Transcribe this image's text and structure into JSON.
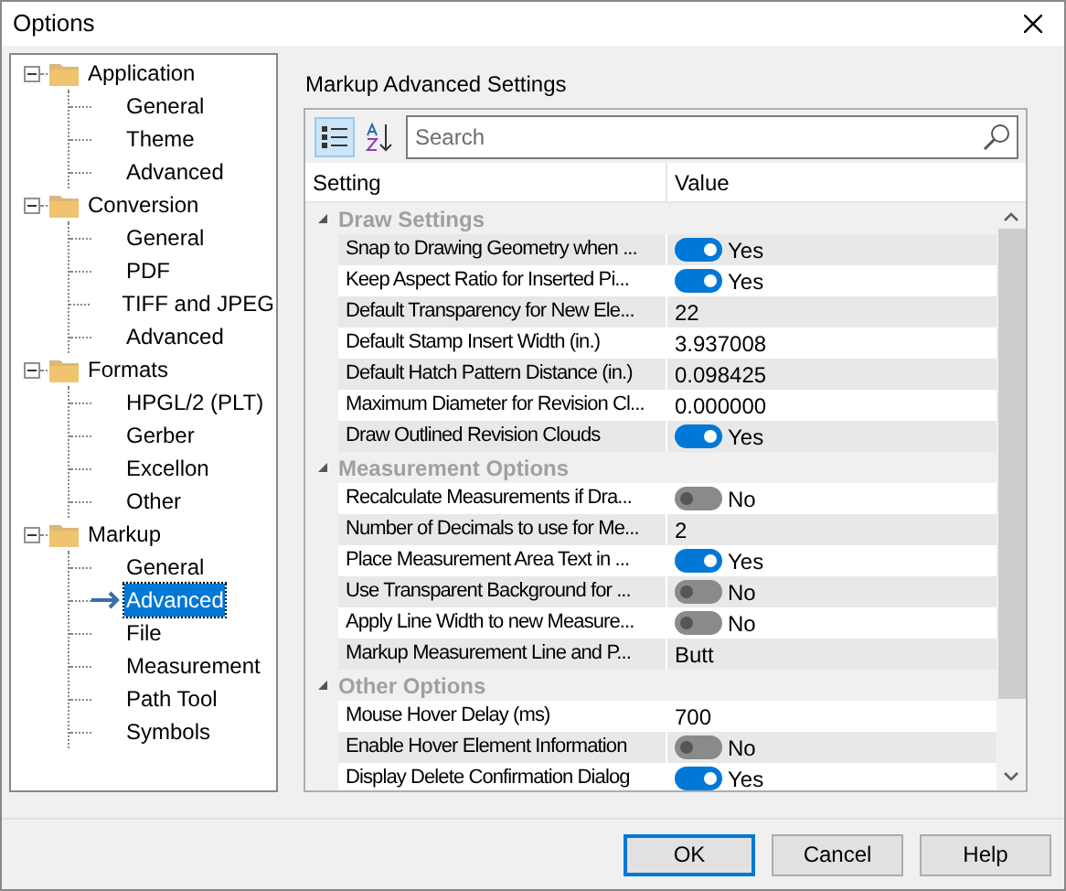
{
  "window": {
    "title": "Options"
  },
  "tree": [
    {
      "label": "Application",
      "expanded": true,
      "children": [
        {
          "label": "General",
          "selected": false
        },
        {
          "label": "Theme",
          "selected": false
        },
        {
          "label": "Advanced",
          "selected": false
        }
      ]
    },
    {
      "label": "Conversion",
      "expanded": true,
      "children": [
        {
          "label": "General",
          "selected": false
        },
        {
          "label": "PDF",
          "selected": false
        },
        {
          "label": "TIFF and JPEG",
          "selected": false
        },
        {
          "label": "Advanced",
          "selected": false
        }
      ]
    },
    {
      "label": "Formats",
      "expanded": true,
      "children": [
        {
          "label": "HPGL/2 (PLT)",
          "selected": false
        },
        {
          "label": "Gerber",
          "selected": false
        },
        {
          "label": "Excellon",
          "selected": false
        },
        {
          "label": "Other",
          "selected": false
        }
      ]
    },
    {
      "label": "Markup",
      "expanded": true,
      "children": [
        {
          "label": "General",
          "selected": false
        },
        {
          "label": "Advanced",
          "selected": true
        },
        {
          "label": "File",
          "selected": false
        },
        {
          "label": "Measurement",
          "selected": false
        },
        {
          "label": "Path Tool",
          "selected": false
        },
        {
          "label": "Symbols",
          "selected": false
        }
      ]
    }
  ],
  "panel_title": "Markup Advanced Settings",
  "search": {
    "placeholder": "Search"
  },
  "grid": {
    "columns": [
      "Setting",
      "Value"
    ],
    "groups": [
      {
        "label": "Draw Settings",
        "expanded": true,
        "rows": [
          {
            "setting": "Snap to Drawing Geometry when ...",
            "kind": "toggle",
            "on": true,
            "value": "Yes"
          },
          {
            "setting": "Keep Aspect Ratio for Inserted Pi...",
            "kind": "toggle",
            "on": true,
            "value": "Yes"
          },
          {
            "setting": "Default Transparency for New Ele...",
            "kind": "text",
            "value": "22"
          },
          {
            "setting": "Default Stamp Insert Width (in.)",
            "kind": "text",
            "value": "3.937008"
          },
          {
            "setting": "Default Hatch Pattern Distance (in.)",
            "kind": "text",
            "value": "0.098425"
          },
          {
            "setting": "Maximum Diameter for Revision Cl...",
            "kind": "text",
            "value": "0.000000"
          },
          {
            "setting": "Draw Outlined Revision Clouds",
            "kind": "toggle",
            "on": true,
            "value": "Yes"
          }
        ]
      },
      {
        "label": "Measurement Options",
        "expanded": true,
        "rows": [
          {
            "setting": "Recalculate Measurements if Dra...",
            "kind": "toggle",
            "on": false,
            "value": "No"
          },
          {
            "setting": "Number of Decimals to use for Me...",
            "kind": "text",
            "value": "2"
          },
          {
            "setting": "Place Measurement Area Text in ...",
            "kind": "toggle",
            "on": true,
            "value": "Yes"
          },
          {
            "setting": "Use Transparent Background for ...",
            "kind": "toggle",
            "on": false,
            "value": "No"
          },
          {
            "setting": "Apply Line Width to new Measure...",
            "kind": "toggle",
            "on": false,
            "value": "No"
          },
          {
            "setting": "Markup Measurement Line and P...",
            "kind": "text",
            "value": "Butt"
          }
        ]
      },
      {
        "label": "Other Options",
        "expanded": true,
        "rows": [
          {
            "setting": "Mouse Hover Delay (ms)",
            "kind": "text",
            "value": "700"
          },
          {
            "setting": "Enable Hover Element Information",
            "kind": "toggle",
            "on": false,
            "value": "No"
          },
          {
            "setting": "Display Delete Confirmation Dialog",
            "kind": "toggle",
            "on": true,
            "value": "Yes"
          }
        ]
      }
    ]
  },
  "buttons": [
    {
      "label": "OK",
      "default": true
    },
    {
      "label": "Cancel",
      "default": false
    },
    {
      "label": "Help",
      "default": false
    }
  ]
}
